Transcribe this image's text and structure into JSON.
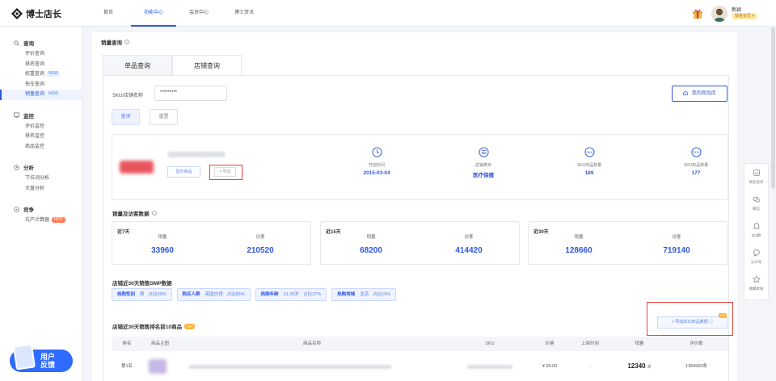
{
  "header": {
    "logo_text": "博士店长",
    "nav": [
      "首页",
      "功能中心",
      "会员中心",
      "博士资讯"
    ],
    "active_nav": 1,
    "user_name": "新颖",
    "vip_label": "铂金会员 ▾"
  },
  "sidebar": {
    "groups": [
      {
        "label": "查询",
        "icon": "search-icon",
        "items": [
          {
            "label": "评价查询"
          },
          {
            "label": "排名查询"
          },
          {
            "label": "权重查询",
            "tag": "NEW"
          },
          {
            "label": "快车查询"
          },
          {
            "label": "销量查询",
            "tag": "NEW",
            "active": true
          }
        ]
      },
      {
        "label": "监控",
        "icon": "monitor-icon",
        "items": [
          {
            "label": "评价监控"
          },
          {
            "label": "排名监控"
          },
          {
            "label": "商品监控"
          }
        ]
      },
      {
        "label": "分析",
        "icon": "clock-icon",
        "items": [
          {
            "label": "下拉词分析"
          },
          {
            "label": "大盘分析"
          }
        ]
      },
      {
        "label": "竞争",
        "icon": "compass-icon",
        "items": [
          {
            "label": "坑产计算器",
            "tag": "HOT"
          }
        ]
      }
    ],
    "feedback": [
      "用户",
      "反馈"
    ]
  },
  "main": {
    "title": "销量查询",
    "tabs": [
      "单品查询",
      "店铺查询"
    ],
    "active_tab": 1,
    "form": {
      "label": "SKU/店铺名称",
      "value": "*********",
      "my_library": "我的商品库",
      "query": "查询",
      "reset": "重置"
    },
    "shop": {
      "show_goods": "显示商品",
      "export": "+ 导出",
      "stats": [
        {
          "label": "开店时间",
          "value": "2015-03-04",
          "icon": "clock-icon"
        },
        {
          "label": "店铺类目",
          "value": "医疗保健",
          "icon": "list-icon"
        },
        {
          "label": "SKU商品数量",
          "value": "189",
          "icon": "sku-icon"
        },
        {
          "label": "SPU商品数量",
          "value": "177",
          "icon": "spu-icon"
        }
      ]
    },
    "sales_title": "销量及访客数据",
    "periods": [
      {
        "name": "近7天",
        "sales_label": "销量",
        "sales": "33960",
        "visitors_label": "访客",
        "visitors": "210520"
      },
      {
        "name": "近15天",
        "sales_label": "销量",
        "sales": "68200",
        "visitors_label": "访客",
        "visitors": "414420"
      },
      {
        "name": "近30天",
        "sales_label": "销量",
        "sales": "128660",
        "visitors_label": "访客",
        "visitors": "719140"
      }
    ],
    "dmp_title": "店铺近30天销售DMP数据",
    "dmp": [
      {
        "k": "热购性别",
        "v": "男",
        "p": "占比50%"
      },
      {
        "k": "购买人群",
        "v": "英国白领",
        "p": "占比83%"
      },
      {
        "k": "热购年龄",
        "v": "31-35岁",
        "p": "占比27%"
      },
      {
        "k": "热购地域",
        "v": "北京",
        "p": "占比19%"
      }
    ],
    "top10_title": "店铺近30天销售排名前10商品",
    "top10_badge": "VIP",
    "export_top10": "+ 导出前10商品数据 ⓘ",
    "export_badge": "VIP",
    "columns": [
      "排名",
      "商品主图",
      "商品名称",
      "SKU",
      "价格",
      "上架时间",
      "销量",
      "评价数"
    ],
    "rows": [
      {
        "rank": "第1名",
        "price": "¥ 99.00",
        "listed": "-",
        "sales": "12340",
        "unit": "单",
        "reviews": "1384960条"
      }
    ]
  },
  "float_bar": [
    "商务合作",
    "微信",
    "QQ群",
    "公众号",
    "收藏本站"
  ]
}
